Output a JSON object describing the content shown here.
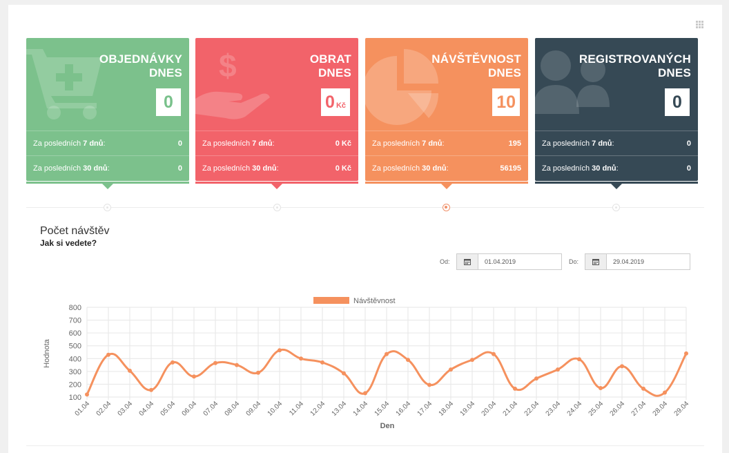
{
  "cards": [
    {
      "title_line1": "OBJEDNÁVKY",
      "title_line2": "DNES",
      "value": "0",
      "unit": "",
      "row1_label_prefix": "Za posledních ",
      "row1_label_bold": "7 dnů",
      "row1_label_suffix": ":",
      "row1_value": "0",
      "row2_label_prefix": "Za posledních ",
      "row2_label_bold": "30 dnů",
      "row2_label_suffix": ":",
      "row2_value": "0",
      "icon": "cart-plus-icon",
      "color": "#7cc18c",
      "text_color": "#79c18b"
    },
    {
      "title_line1": "OBRAT",
      "title_line2": "DNES",
      "value": "0",
      "unit": "Kč",
      "row1_label_prefix": "Za posledních ",
      "row1_label_bold": "7 dnů",
      "row1_label_suffix": ":",
      "row1_value": "0 Kč",
      "row2_label_prefix": "Za posledních ",
      "row2_label_bold": "30 dnů",
      "row2_label_suffix": ":",
      "row2_value": "0 Kč",
      "icon": "hand-dollar-icon",
      "color": "#f2636a",
      "text_color": "#f2636a"
    },
    {
      "title_line1": "NÁVŠTĚVNOST",
      "title_line2": "DNES",
      "value": "10",
      "unit": "",
      "row1_label_prefix": "Za posledních ",
      "row1_label_bold": "7 dnů",
      "row1_label_suffix": ":",
      "row1_value": "195",
      "row2_label_prefix": "Za posledních ",
      "row2_label_bold": "30 dnů",
      "row2_label_suffix": ":",
      "row2_value": "56195",
      "icon": "pie-chart-icon",
      "color": "#f5915e",
      "text_color": "#f5915e"
    },
    {
      "title_line1": "REGISTROVANÝCH",
      "title_line2": "DNES",
      "value": "0",
      "unit": "",
      "row1_label_prefix": "Za posledních ",
      "row1_label_bold": "7 dnů",
      "row1_label_suffix": ":",
      "row1_value": "0",
      "row2_label_prefix": "Za posledních ",
      "row2_label_bold": "30 dnů",
      "row2_label_suffix": ":",
      "row2_value": "0",
      "icon": "users-icon",
      "color": "#364955",
      "text_color": "#364955"
    }
  ],
  "section": {
    "title": "Počet návštěv",
    "subtitle": "Jak si vedete?"
  },
  "filters": {
    "from_label": "Od:",
    "from_value": "01.04.2019",
    "to_label": "Do:",
    "to_value": "29.04.2019"
  },
  "chart_data": {
    "type": "line",
    "legend_position": "top-center",
    "series": [
      {
        "name": "Návštěvnost",
        "color": "#f5915e",
        "values": [
          120,
          430,
          305,
          155,
          370,
          260,
          365,
          350,
          290,
          465,
          400,
          370,
          285,
          130,
          435,
          390,
          195,
          315,
          390,
          435,
          165,
          245,
          315,
          395,
          170,
          340,
          165,
          135,
          440
        ]
      }
    ],
    "categories": [
      "01.04",
      "02.04",
      "03.04",
      "04.04",
      "05.04",
      "06.04",
      "07.04",
      "08.04",
      "09.04",
      "10.04",
      "11.04",
      "12.04",
      "13.04",
      "14.04",
      "15.04",
      "16.04",
      "17.04",
      "18.04",
      "19.04",
      "20.04",
      "21.04",
      "22.04",
      "23.04",
      "24.04",
      "25.04",
      "26.04",
      "27.04",
      "28.04",
      "29.04"
    ],
    "xlabel": "Den",
    "ylabel": "Hodnota",
    "ylim": [
      100,
      800
    ],
    "yticks": [
      100,
      200,
      300,
      400,
      500,
      600,
      700,
      800
    ],
    "grid": true
  }
}
